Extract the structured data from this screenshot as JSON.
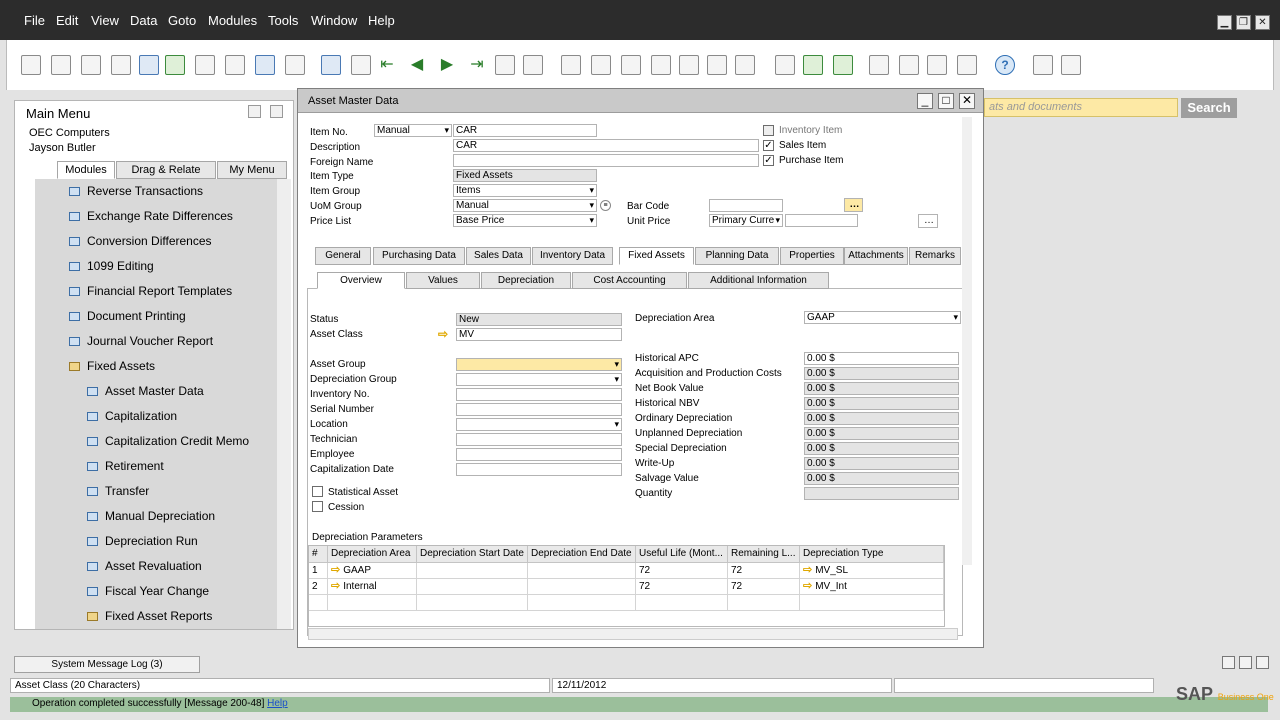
{
  "menubar": {
    "items": [
      "File",
      "Edit",
      "View",
      "Data",
      "Goto",
      "Modules",
      "Tools",
      "Window",
      "Help"
    ]
  },
  "main_menu": {
    "title": "Main Menu",
    "company": "OEC Computers",
    "user": "Jayson Butler",
    "tabs": [
      "Modules",
      "Drag & Relate",
      "My Menu"
    ],
    "items": [
      {
        "label": "Reverse Transactions",
        "icon": "form-icon",
        "indent": 0
      },
      {
        "label": "Exchange Rate Differences",
        "icon": "form-icon",
        "indent": 0
      },
      {
        "label": "Conversion Differences",
        "icon": "form-icon",
        "indent": 0
      },
      {
        "label": "1099 Editing",
        "icon": "form-icon",
        "indent": 0
      },
      {
        "label": "Financial Report Templates",
        "icon": "form-icon",
        "indent": 0
      },
      {
        "label": "Document Printing",
        "icon": "form-icon",
        "indent": 0
      },
      {
        "label": "Journal Voucher Report",
        "icon": "form-icon",
        "indent": 0
      },
      {
        "label": "Fixed Assets",
        "icon": "folder-open-icon",
        "indent": 0
      },
      {
        "label": "Asset Master Data",
        "icon": "form-icon",
        "indent": 1
      },
      {
        "label": "Capitalization",
        "icon": "form-icon",
        "indent": 1
      },
      {
        "label": "Capitalization Credit Memo",
        "icon": "form-icon",
        "indent": 1
      },
      {
        "label": "Retirement",
        "icon": "form-icon",
        "indent": 1
      },
      {
        "label": "Transfer",
        "icon": "form-icon",
        "indent": 1
      },
      {
        "label": "Manual Depreciation",
        "icon": "form-icon",
        "indent": 1
      },
      {
        "label": "Depreciation Run",
        "icon": "form-icon",
        "indent": 1
      },
      {
        "label": "Asset Revaluation",
        "icon": "form-icon",
        "indent": 1
      },
      {
        "label": "Fiscal Year Change",
        "icon": "form-icon",
        "indent": 1
      },
      {
        "label": "Fixed Asset Reports",
        "icon": "folder-icon",
        "indent": 1
      }
    ]
  },
  "search": {
    "placeholder": "ats and documents",
    "button": "Search"
  },
  "asset_window": {
    "title": "Asset Master Data",
    "header": {
      "item_no_label": "Item No.",
      "item_no_mode": "Manual",
      "item_no": "CAR",
      "description_label": "Description",
      "description": "CAR",
      "foreign_name_label": "Foreign Name",
      "foreign_name": "",
      "item_type_label": "Item Type",
      "item_type": "Fixed Assets",
      "item_group_label": "Item Group",
      "item_group": "Items",
      "uom_group_label": "UoM Group",
      "uom_group": "Manual",
      "price_list_label": "Price List",
      "price_list": "Base Price",
      "bar_code_label": "Bar Code",
      "bar_code": "",
      "unit_price_label": "Unit Price",
      "unit_price_mode": "Primary Curre",
      "inventory_item": "Inventory Item",
      "sales_item": "Sales Item",
      "purchase_item": "Purchase Item",
      "inventory_checked": false,
      "sales_checked": true,
      "purchase_checked": true
    },
    "tabs": [
      "General",
      "Purchasing Data",
      "Sales Data",
      "Inventory Data",
      "Fixed Assets",
      "Planning Data",
      "Properties",
      "Attachments",
      "Remarks"
    ],
    "subtabs": [
      "Overview",
      "Values",
      "Depreciation",
      "Cost Accounting",
      "Additional Information"
    ],
    "left_fields": [
      {
        "label": "Status",
        "value": "New",
        "style": "gray"
      },
      {
        "label": "Asset Class",
        "value": "MV",
        "style": "plain"
      },
      {
        "label": "Asset Group",
        "value": "",
        "style": "yel dd"
      },
      {
        "label": "Depreciation Group",
        "value": "",
        "style": "dd"
      },
      {
        "label": "Inventory No.",
        "value": "",
        "style": "plain"
      },
      {
        "label": "Serial Number",
        "value": "",
        "style": "plain"
      },
      {
        "label": "Location",
        "value": "",
        "style": "dd"
      },
      {
        "label": "Technician",
        "value": "",
        "style": "plain"
      },
      {
        "label": "Employee",
        "value": "",
        "style": "plain"
      },
      {
        "label": "Capitalization Date",
        "value": "",
        "style": "plain"
      }
    ],
    "statistical_asset": "Statistical Asset",
    "cession": "Cession",
    "depreciation_area_label": "Depreciation Area",
    "depreciation_area": "GAAP",
    "right_fields": [
      {
        "label": "Historical APC",
        "value": "0.00 $",
        "style": "plain"
      },
      {
        "label": "Acquisition and Production Costs",
        "value": "0.00 $",
        "style": "gray"
      },
      {
        "label": "Net Book Value",
        "value": "0.00 $",
        "style": "gray"
      },
      {
        "label": "Historical NBV",
        "value": "0.00 $",
        "style": "gray"
      },
      {
        "label": "Ordinary Depreciation",
        "value": "0.00 $",
        "style": "gray"
      },
      {
        "label": "Unplanned Depreciation",
        "value": "0.00 $",
        "style": "gray"
      },
      {
        "label": "Special Depreciation",
        "value": "0.00 $",
        "style": "gray"
      },
      {
        "label": "Write-Up",
        "value": "0.00 $",
        "style": "gray"
      },
      {
        "label": "Salvage Value",
        "value": "0.00 $",
        "style": "gray"
      },
      {
        "label": "Quantity",
        "value": "",
        "style": "gray"
      }
    ],
    "params_title": "Depreciation Parameters",
    "grid_headers": [
      "#",
      "Depreciation Area",
      "Depreciation Start Date",
      "Depreciation End Date",
      "Useful Life (Mont...",
      "Remaining L...",
      "Depreciation Type"
    ],
    "grid_rows": [
      [
        "1",
        "GAAP",
        "",
        "",
        "72",
        "72",
        "MV_SL"
      ],
      [
        "2",
        "Internal",
        "",
        "",
        "72",
        "72",
        "MV_Int"
      ]
    ]
  },
  "taskbar": {
    "label": "System Message Log (3)"
  },
  "status": {
    "field": "Asset Class (20 Characters)",
    "date": "12/11/2012"
  },
  "message": {
    "text": "Operation completed successfully  [Message 200-48]",
    "help": "Help"
  },
  "brand": {
    "name": "SAP",
    "product": "Business One"
  }
}
